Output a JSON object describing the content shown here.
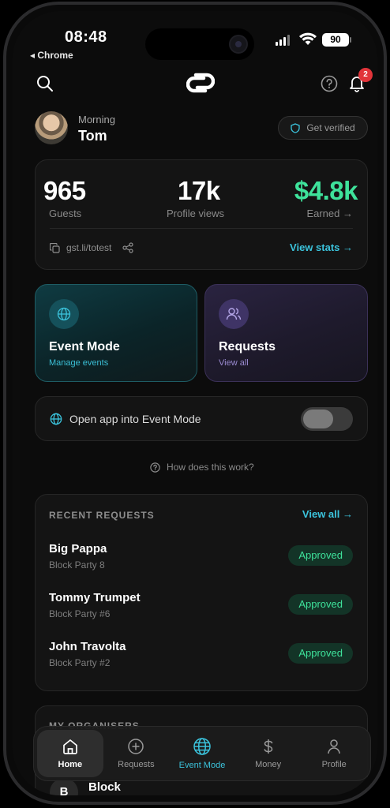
{
  "status_bar": {
    "time": "08:48",
    "back_app": "◂ Chrome",
    "battery": "90"
  },
  "header": {
    "notifications_count": "2",
    "icons": [
      "search-icon",
      "logo-icon",
      "help-icon",
      "bell-icon"
    ]
  },
  "greeting": {
    "salutation": "Morning",
    "name": "Tom",
    "verify_label": "Get verified"
  },
  "stats": {
    "guests_value": "965",
    "guests_label": "Guests",
    "views_value": "17k",
    "views_label": "Profile views",
    "earned_value": "$4.8k",
    "earned_label": "Earned →",
    "link": "gst.li/totest",
    "view_stats": "View stats →"
  },
  "tiles": {
    "event_title": "Event Mode",
    "event_sub": "Manage events",
    "requests_title": "Requests",
    "requests_sub": "View all"
  },
  "toggle": {
    "label": "Open app into Event Mode",
    "on": false
  },
  "how_link": "How does this work?",
  "recent_requests": {
    "title": "RECENT REQUESTS",
    "view_all": "View all →",
    "items": [
      {
        "name": "Big Pappa",
        "event": "Block Party 8",
        "status": "Approved"
      },
      {
        "name": "Tommy Trumpet",
        "event": "Block Party #6",
        "status": "Approved"
      },
      {
        "name": "John Travolta",
        "event": "Block Party #2",
        "status": "Approved"
      }
    ]
  },
  "organisers": {
    "title": "MY ORGANISERS",
    "first_initial": "B",
    "first_name": "Block"
  },
  "tabbar": {
    "tabs": [
      {
        "label": "Home",
        "icon": "home-icon"
      },
      {
        "label": "Requests",
        "icon": "plus-circle-icon"
      },
      {
        "label": "Event Mode",
        "icon": "globe-icon"
      },
      {
        "label": "Money",
        "icon": "dollar-icon"
      },
      {
        "label": "Profile",
        "icon": "user-icon"
      }
    ]
  },
  "colors": {
    "accent_cyan": "#3bc3dc",
    "accent_green": "#3ee29b",
    "badge_red": "#e2343a"
  }
}
